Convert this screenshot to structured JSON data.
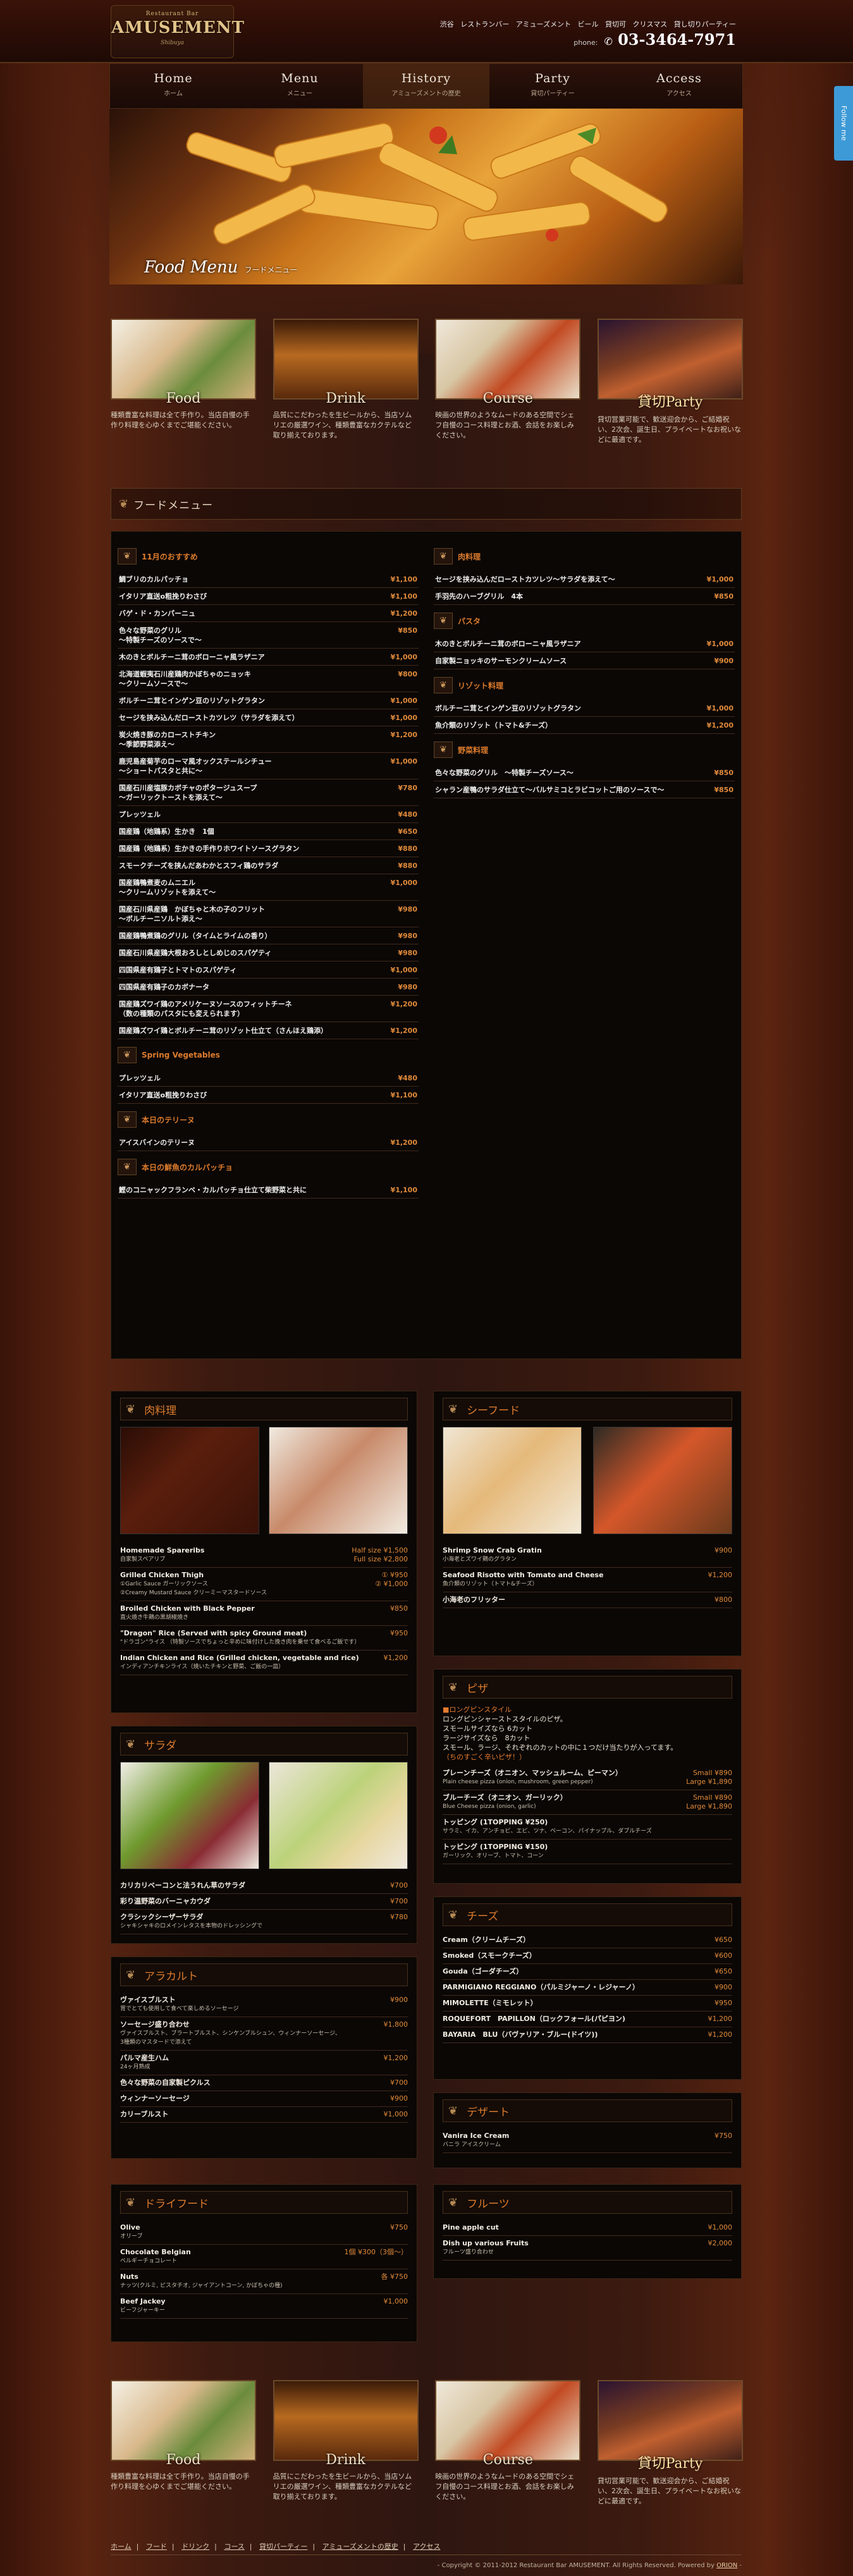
{
  "header": {
    "logo_small": "Restaurant Bar",
    "logo_main": "AMUSEMENT",
    "logo_sub": "Shibuya",
    "top_links": [
      "渋谷",
      "レストランバー",
      "アミューズメント",
      "ビール",
      "貸切可",
      "クリスマス",
      "貸し切りパーティー"
    ],
    "phone_label": "phone:",
    "phone_number": "03-3464-7971"
  },
  "nav": [
    {
      "en": "Home",
      "ja": "ホーム"
    },
    {
      "en": "Menu",
      "ja": "メニュー"
    },
    {
      "en": "History",
      "ja": "アミューズメントの歴史"
    },
    {
      "en": "Party",
      "ja": "貸切パーティー"
    },
    {
      "en": "Access",
      "ja": "アクセス"
    }
  ],
  "hero": {
    "en": "Food Menu",
    "ja": "フードメニュー"
  },
  "follow": "Follow me",
  "cats": [
    {
      "en": "Food",
      "desc": "種類豊富な料理は全て手作り。当店自慢の手作り料理を心ゆくまでご堪能ください。"
    },
    {
      "en": "Drink",
      "desc": "品質にこだわったを生ビールから、当店ソムリエの厳選ワイン、種類豊富なカクテルなど取り揃えております。"
    },
    {
      "en": "Course",
      "desc": "映画の世界のようなムードのある空間でシェフ自慢のコース料理とお酒、会話をお楽しみください。"
    },
    {
      "en": "貸切Party",
      "desc": "貸切営業可能で、歓送迎会から、ご結婚祝い、2次会、誕生日、プライベートなお祝いなどに最適です。"
    }
  ],
  "section_title": "フードメニュー",
  "menu_left": [
    {
      "head": "11月のおすすめ",
      "items": [
        [
          "鯛ブリのカルパッチョ",
          "¥1,100"
        ],
        [
          "イタリア直送o粗挽りわさび",
          "¥1,100"
        ],
        [
          "バゲ・ド・カンパーニュ",
          "¥1,200"
        ],
        [
          "色々な野菜のグリル\n〜特製チーズのソースで〜",
          "¥850"
        ],
        [
          "木のきとボルチーニ茸のボローニャ風ラザニア",
          "¥1,000"
        ],
        [
          "北海道蝦夷石川産鶏肉かぼちゃのニョッキ\n〜クリームソースで〜",
          "¥800"
        ],
        [
          "ボルチーニ茸とインゲン豆のリゾットグラタン",
          "¥1,000"
        ],
        [
          "セージを挟み込んだローストカツレツ（サラダを添えて）",
          "¥1,000"
        ],
        [
          "炭火焼き豚のカローストチキン\n〜季節野菜添え〜",
          "¥1,200"
        ],
        [
          "鹿児島産菊芋のローマ風オックステールシチュー\n〜ショートパスタと共に〜",
          "¥1,000"
        ],
        [
          "国産石川産塩豚カボチャのポタージュスープ\n〜ガーリックトーストを添えて〜",
          "¥780"
        ],
        [
          "プレッツェル",
          "¥480"
        ],
        [
          "国産鶏（地鶏系）生かき　1個",
          "¥650"
        ],
        [
          "国産鶏（地鶏系）生かきの手作りホワイトソースグラタン",
          "¥880"
        ],
        [
          "スモークチーズを挟んだあわかとスフィ鶏のサラダ",
          "¥880"
        ],
        [
          "国産鶏鴨煮麦のムニエル\n〜クリームリゾットを添えて〜",
          "¥1,000"
        ],
        [
          "国産石川県産鶏　かぼちゃと木の子のフリット\n〜ボルチーニソルト添え〜",
          "¥980"
        ],
        [
          "国産鶏鴨煮鶏のグリル（タイムとライムの香り）",
          "¥980"
        ],
        [
          "国産石川県産鶏大根おろしとしめじのスパゲティ",
          "¥980"
        ],
        [
          "四国県産有鶏子とトマトのスパゲティ",
          "¥1,000"
        ],
        [
          "四国県産有鶏子のカボナータ",
          "¥980"
        ],
        [
          "国産鶏ズワイ鶏のアメリケーヌソースのフィットチーネ\n（数の種類のパスタにも変えられます）",
          "¥1,200"
        ],
        [
          "国産鶏ズワイ鶏とボルチーニ茸のリゾット仕立て（さんほえ鶏添）",
          "¥1,200"
        ]
      ]
    },
    {
      "head": "Spring Vegetables",
      "items": [
        [
          "プレッツェル",
          "¥480"
        ],
        [
          "イタリア直送o粗挽りわさび",
          "¥1,100"
        ]
      ]
    },
    {
      "head": "本日のテリーヌ",
      "items": [
        [
          "アイスバインのテリーヌ",
          "¥1,200"
        ]
      ]
    },
    {
      "head": "本日の鮮魚のカルパッチョ",
      "items": [
        [
          "鰹のコニャックフランベ・カルパッチョ仕立て柴野菜と共に",
          "¥1,100"
        ]
      ]
    }
  ],
  "menu_right": [
    {
      "head": "肉料理",
      "items": [
        [
          "セージを挟み込んだローストカツレツ〜サラダを添えて〜",
          "¥1,000"
        ],
        [
          "手羽先のハーブグリル　4本",
          "¥850"
        ]
      ]
    },
    {
      "head": "パスタ",
      "items": [
        [
          "木のきとボルチーニ茸のボローニャ風ラザニア",
          "¥1,000"
        ],
        [
          "自家製ニョッキのサーモンクリームソース",
          "¥900"
        ]
      ]
    },
    {
      "head": "リゾット料理",
      "items": [
        [
          "ボルチーニ茸とインゲン豆のリゾットグラタン",
          "¥1,000"
        ],
        [
          "魚介類のリゾット（トマト&チーズ）",
          "¥1,200"
        ]
      ]
    },
    {
      "head": "野菜料理",
      "items": [
        [
          "色々な野菜のグリル　〜特製チーズソース〜",
          "¥850"
        ],
        [
          "シャラン産鴨のサラダ仕立て〜バルサミコとラビコットご用のソースで〜",
          "¥850"
        ]
      ]
    }
  ],
  "meat": {
    "title": "肉料理",
    "items": [
      {
        "n": "Homemade Spareribs",
        "s": "自家製スペアリブ",
        "p": "Half size ¥1,500\nFull size ¥2,800"
      },
      {
        "n": "Grilled Chicken Thigh",
        "s": "①Garlic Sauce ガーリックソース\n②Creamy Mustard Sauce クリーミーマスタードソース",
        "p": "① ¥950\n② ¥1,000"
      },
      {
        "n": "Broiled Chicken with Black Pepper",
        "s": "直火焼き牛鶏の黒胡椒焼き",
        "p": "¥850"
      },
      {
        "n": "\"Dragon\" Rice (Served with spicy Ground meat)",
        "s": "\"ドラゴン\"ライス （特製ソースでちょっと辛めに味付けした挽き肉を乗せて食べるご飯です）",
        "p": "¥950"
      },
      {
        "n": "Indian Chicken and Rice (Grilled chicken, vegetable and rice)",
        "s": "インディアンチキンライス（焼いたチキンと野菜、ご飯の一皿）",
        "p": "¥1,200"
      }
    ]
  },
  "salad": {
    "title": "サラダ",
    "items": [
      {
        "n": "カリカリベーコンと法うれん草のサラダ",
        "s": "",
        "p": "¥700"
      },
      {
        "n": "彩り温野菜のバーニャカウダ",
        "s": "",
        "p": "¥700"
      },
      {
        "n": "クラシックシーザーサラダ",
        "s": "シャキシャキのロメインレタスを本物のドレッシングで",
        "p": "¥780"
      }
    ]
  },
  "alacarte": {
    "title": "アラカルト",
    "items": [
      {
        "n": "ヴァイスブルスト",
        "s": "胃でとても使用して食べて楽しめるソーセージ",
        "p": "¥900"
      },
      {
        "n": "ソーセージ盛り合わせ",
        "s": "ヴァイスブルスト、ブラートブルスト、シンケンブルシュン、ウィンナーソーセージ、\n3種類のマスタードで添えて",
        "p": "¥1,800"
      },
      {
        "n": "パルマ産生ハム",
        "s": "24ヶ月熟成",
        "p": "¥1,200"
      },
      {
        "n": "色々な野菜の自家製ピクルス",
        "s": "",
        "p": "¥700"
      },
      {
        "n": "ウィンナーソーセージ",
        "s": "",
        "p": "¥900"
      },
      {
        "n": "カリーブルスト",
        "s": "",
        "p": "¥1,000"
      }
    ]
  },
  "dryfood": {
    "title": "ドライフード",
    "items": [
      {
        "n": "Olive",
        "s": "オリーブ",
        "p": "¥750"
      },
      {
        "n": "Chocolate Belgian",
        "s": "ベルギーチョコレート",
        "p": "1個 ¥300（3個〜）"
      },
      {
        "n": "Nuts",
        "s": "ナッツ(クルミ, ピスタチオ, ジャイアントコーン, かぼちゃの種)",
        "p": "各 ¥750"
      },
      {
        "n": "Beef Jackey",
        "s": "ビーフジャーキー",
        "p": "¥1,000"
      }
    ]
  },
  "seafood": {
    "title": "シーフード",
    "items": [
      {
        "n": "Shrimp Snow Crab Gratin",
        "s": "小海老とズワイ鶏のグラタン",
        "p": "¥900"
      },
      {
        "n": "Seafood Risotto with Tomato and Cheese",
        "s": "魚介類のリゾット（トマト&チーズ）",
        "p": "¥1,200"
      },
      {
        "n": "小海老のフリッター",
        "s": "",
        "p": "¥800"
      }
    ]
  },
  "pizza": {
    "title": "ピザ",
    "head": "■ロングピンスタイル",
    "notes": [
      "ロングピンシャーストスタイルのピザ。",
      "スモールサイズなら 6カット",
      "ラージサイズなら　8カット",
      "スモール、ラージ、それぞれのカットの中に１つだけ当たりが入ってます。"
    ],
    "note2": "（ちのすごく辛いピザ！）",
    "items": [
      {
        "n": "プレーンチーズ（オニオン、マッシュルーム、ピーマン）",
        "s": "Plain cheese pizza (onion, mushroom, green pepper)",
        "p": "Small ¥890\nLarge ¥1,890"
      },
      {
        "n": "ブルーチーズ（オニオン、ガーリック）",
        "s": "Blue Cheese pizza (onion, garlic)",
        "p": "Small ¥890\nLarge ¥1,890"
      },
      {
        "n": "トッピング (1TOPPING ¥250)",
        "s": "サラミ、イカ、アンチョビ、エビ、ツナ、ベーコン、パイナップル、ダブルチーズ",
        "p": ""
      },
      {
        "n": "トッピング (1TOPPING ¥150)",
        "s": "ガーリック、オリーブ、トマト、コーン",
        "p": ""
      }
    ]
  },
  "cheese": {
    "title": "チーズ",
    "items": [
      {
        "n": "Cream（クリームチーズ）",
        "s": "",
        "p": "¥650"
      },
      {
        "n": "Smoked（スモークチーズ）",
        "s": "",
        "p": "¥600"
      },
      {
        "n": "Gouda（ゴーダチーズ）",
        "s": "",
        "p": "¥650"
      },
      {
        "n": "PARMIGIANO REGGIANO（パルミジャーノ・レジャーノ）",
        "s": "",
        "p": "¥900"
      },
      {
        "n": "MIMOLETTE（ミモレット）",
        "s": "",
        "p": "¥950"
      },
      {
        "n": "ROQUEFORT　PAPILLON（ロックフォール(パピヨン)",
        "s": "",
        "p": "¥1,200"
      },
      {
        "n": "BAYARIA　BLU（バヴァリア・ブルー(ドイツ))",
        "s": "",
        "p": "¥1,200"
      }
    ]
  },
  "dessert": {
    "title": "デザート",
    "items": [
      {
        "n": "Vanira Ice Cream",
        "s": "バニラ アイスクリーム",
        "p": "¥750"
      }
    ]
  },
  "fruits": {
    "title": "フルーツ",
    "items": [
      {
        "n": "Pine apple cut",
        "s": "",
        "p": "¥1,000"
      },
      {
        "n": "Dish up various Fruits",
        "s": "フルーツ盛り合わせ",
        "p": "¥2,000"
      }
    ]
  },
  "footer": {
    "links": [
      "ホーム",
      "フード",
      "ドリンク",
      "コース",
      "貸切パーティー",
      "アミューズメントの歴史",
      "アクセス"
    ],
    "copyright": "- Copyright © 2011-2012 Restaurant Bar AMUSEMENT. All Rights Reserved. Powered by ",
    "powered": "ORION",
    "end": " -"
  }
}
